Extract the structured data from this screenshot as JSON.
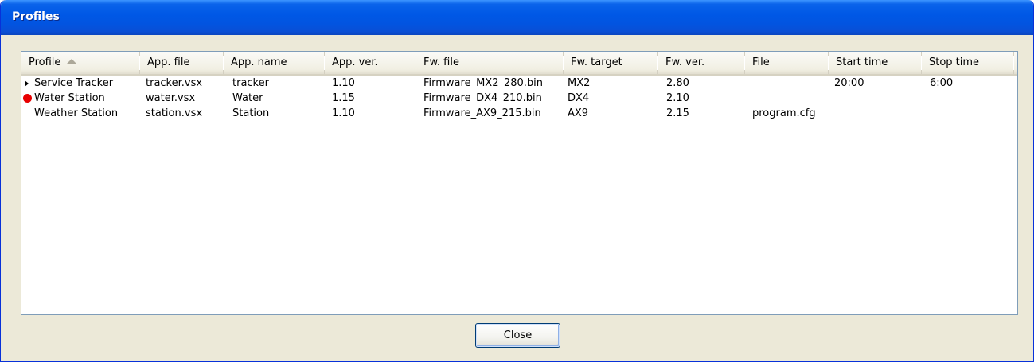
{
  "window": {
    "title": "Profiles"
  },
  "table": {
    "columns": [
      {
        "label": "Profile"
      },
      {
        "label": "App. file"
      },
      {
        "label": "App. name"
      },
      {
        "label": "App. ver."
      },
      {
        "label": "Fw. file"
      },
      {
        "label": "Fw. target"
      },
      {
        "label": "Fw. ver."
      },
      {
        "label": "File"
      },
      {
        "label": "Start time"
      },
      {
        "label": "Stop time"
      }
    ],
    "sort_indicator": "sort-ascending-icon",
    "rows": [
      {
        "marker": "play-arrow-icon",
        "cells": [
          "Service Tracker",
          "tracker.vsx",
          "tracker",
          "1.10",
          "Firmware_MX2_280.bin",
          "MX2",
          "2.80",
          "",
          "20:00",
          "6:00"
        ]
      },
      {
        "marker": "red-dot-icon",
        "cells": [
          "Water Station",
          "water.vsx",
          "Water",
          "1.15",
          "Firmware_DX4_210.bin",
          "DX4",
          "2.10",
          "",
          "",
          ""
        ]
      },
      {
        "marker": "",
        "cells": [
          "Weather Station",
          "station.vsx",
          "Station",
          "1.10",
          "Firmware_AX9_215.bin",
          "AX9",
          "2.15",
          "program.cfg",
          "",
          ""
        ]
      }
    ]
  },
  "buttons": {
    "close_label": "Close"
  },
  "colors": {
    "titlebar": "#0058e6",
    "dialog_bg": "#ece9d8",
    "marker_red": "#e80000"
  }
}
